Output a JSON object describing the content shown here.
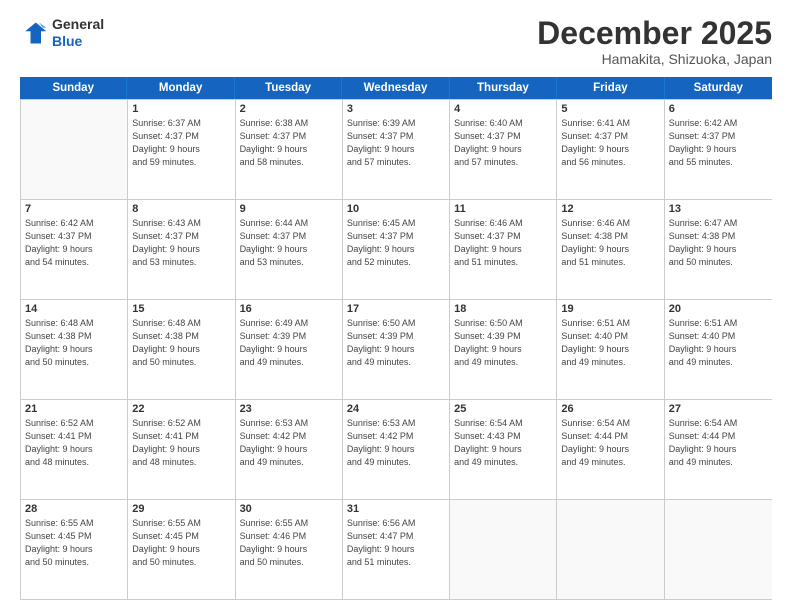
{
  "logo": {
    "line1": "General",
    "line2": "Blue"
  },
  "title": "December 2025",
  "subtitle": "Hamakita, Shizuoka, Japan",
  "header_days": [
    "Sunday",
    "Monday",
    "Tuesday",
    "Wednesday",
    "Thursday",
    "Friday",
    "Saturday"
  ],
  "weeks": [
    [
      {
        "day": "",
        "info": ""
      },
      {
        "day": "1",
        "info": "Sunrise: 6:37 AM\nSunset: 4:37 PM\nDaylight: 9 hours\nand 59 minutes."
      },
      {
        "day": "2",
        "info": "Sunrise: 6:38 AM\nSunset: 4:37 PM\nDaylight: 9 hours\nand 58 minutes."
      },
      {
        "day": "3",
        "info": "Sunrise: 6:39 AM\nSunset: 4:37 PM\nDaylight: 9 hours\nand 57 minutes."
      },
      {
        "day": "4",
        "info": "Sunrise: 6:40 AM\nSunset: 4:37 PM\nDaylight: 9 hours\nand 57 minutes."
      },
      {
        "day": "5",
        "info": "Sunrise: 6:41 AM\nSunset: 4:37 PM\nDaylight: 9 hours\nand 56 minutes."
      },
      {
        "day": "6",
        "info": "Sunrise: 6:42 AM\nSunset: 4:37 PM\nDaylight: 9 hours\nand 55 minutes."
      }
    ],
    [
      {
        "day": "7",
        "info": "Sunrise: 6:42 AM\nSunset: 4:37 PM\nDaylight: 9 hours\nand 54 minutes."
      },
      {
        "day": "8",
        "info": "Sunrise: 6:43 AM\nSunset: 4:37 PM\nDaylight: 9 hours\nand 53 minutes."
      },
      {
        "day": "9",
        "info": "Sunrise: 6:44 AM\nSunset: 4:37 PM\nDaylight: 9 hours\nand 53 minutes."
      },
      {
        "day": "10",
        "info": "Sunrise: 6:45 AM\nSunset: 4:37 PM\nDaylight: 9 hours\nand 52 minutes."
      },
      {
        "day": "11",
        "info": "Sunrise: 6:46 AM\nSunset: 4:37 PM\nDaylight: 9 hours\nand 51 minutes."
      },
      {
        "day": "12",
        "info": "Sunrise: 6:46 AM\nSunset: 4:38 PM\nDaylight: 9 hours\nand 51 minutes."
      },
      {
        "day": "13",
        "info": "Sunrise: 6:47 AM\nSunset: 4:38 PM\nDaylight: 9 hours\nand 50 minutes."
      }
    ],
    [
      {
        "day": "14",
        "info": "Sunrise: 6:48 AM\nSunset: 4:38 PM\nDaylight: 9 hours\nand 50 minutes."
      },
      {
        "day": "15",
        "info": "Sunrise: 6:48 AM\nSunset: 4:38 PM\nDaylight: 9 hours\nand 50 minutes."
      },
      {
        "day": "16",
        "info": "Sunrise: 6:49 AM\nSunset: 4:39 PM\nDaylight: 9 hours\nand 49 minutes."
      },
      {
        "day": "17",
        "info": "Sunrise: 6:50 AM\nSunset: 4:39 PM\nDaylight: 9 hours\nand 49 minutes."
      },
      {
        "day": "18",
        "info": "Sunrise: 6:50 AM\nSunset: 4:39 PM\nDaylight: 9 hours\nand 49 minutes."
      },
      {
        "day": "19",
        "info": "Sunrise: 6:51 AM\nSunset: 4:40 PM\nDaylight: 9 hours\nand 49 minutes."
      },
      {
        "day": "20",
        "info": "Sunrise: 6:51 AM\nSunset: 4:40 PM\nDaylight: 9 hours\nand 49 minutes."
      }
    ],
    [
      {
        "day": "21",
        "info": "Sunrise: 6:52 AM\nSunset: 4:41 PM\nDaylight: 9 hours\nand 48 minutes."
      },
      {
        "day": "22",
        "info": "Sunrise: 6:52 AM\nSunset: 4:41 PM\nDaylight: 9 hours\nand 48 minutes."
      },
      {
        "day": "23",
        "info": "Sunrise: 6:53 AM\nSunset: 4:42 PM\nDaylight: 9 hours\nand 49 minutes."
      },
      {
        "day": "24",
        "info": "Sunrise: 6:53 AM\nSunset: 4:42 PM\nDaylight: 9 hours\nand 49 minutes."
      },
      {
        "day": "25",
        "info": "Sunrise: 6:54 AM\nSunset: 4:43 PM\nDaylight: 9 hours\nand 49 minutes."
      },
      {
        "day": "26",
        "info": "Sunrise: 6:54 AM\nSunset: 4:44 PM\nDaylight: 9 hours\nand 49 minutes."
      },
      {
        "day": "27",
        "info": "Sunrise: 6:54 AM\nSunset: 4:44 PM\nDaylight: 9 hours\nand 49 minutes."
      }
    ],
    [
      {
        "day": "28",
        "info": "Sunrise: 6:55 AM\nSunset: 4:45 PM\nDaylight: 9 hours\nand 50 minutes."
      },
      {
        "day": "29",
        "info": "Sunrise: 6:55 AM\nSunset: 4:45 PM\nDaylight: 9 hours\nand 50 minutes."
      },
      {
        "day": "30",
        "info": "Sunrise: 6:55 AM\nSunset: 4:46 PM\nDaylight: 9 hours\nand 50 minutes."
      },
      {
        "day": "31",
        "info": "Sunrise: 6:56 AM\nSunset: 4:47 PM\nDaylight: 9 hours\nand 51 minutes."
      },
      {
        "day": "",
        "info": ""
      },
      {
        "day": "",
        "info": ""
      },
      {
        "day": "",
        "info": ""
      }
    ]
  ]
}
